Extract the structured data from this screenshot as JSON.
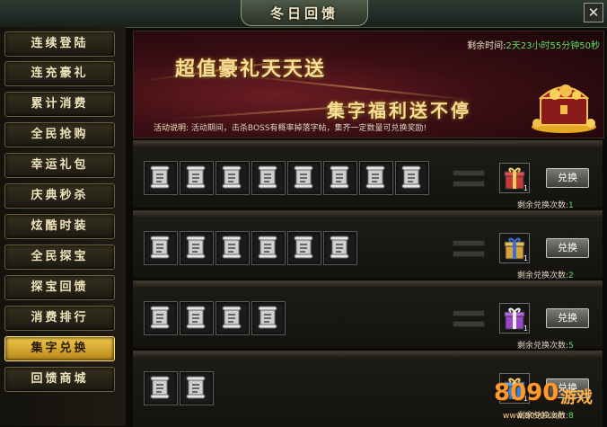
{
  "window": {
    "title": "冬日回馈",
    "close_glyph": "✕"
  },
  "sidebar": {
    "items": [
      {
        "label": "连续登陆",
        "active": false
      },
      {
        "label": "连充豪礼",
        "active": false
      },
      {
        "label": "累计消费",
        "active": false
      },
      {
        "label": "全民抢购",
        "active": false
      },
      {
        "label": "幸运礼包",
        "active": false
      },
      {
        "label": "庆典秒杀",
        "active": false
      },
      {
        "label": "炫酷时装",
        "active": false
      },
      {
        "label": "全民探宝",
        "active": false
      },
      {
        "label": "探宝回馈",
        "active": false
      },
      {
        "label": "消费排行",
        "active": false
      },
      {
        "label": "集字兑换",
        "active": true
      },
      {
        "label": "回馈商城",
        "active": false
      }
    ]
  },
  "banner": {
    "title1": "超值豪礼天天送",
    "title2": "集字福利送不停",
    "time_label": "剩余时间:",
    "time_value": "2天23小时55分钟50秒",
    "desc_label": "活动说明:",
    "desc_text": "活动期间，击杀BOSS有概率掉落字帖，集齐一定数量可兑换奖励!",
    "chest_icon": "treasure-chest-icon"
  },
  "rows": [
    {
      "slots": 8,
      "reward_icon": "gift-box-icon",
      "reward_color": "#c63a3a",
      "reward_count": "1",
      "button": "兑换",
      "remain_label": "剩余兑换次数:",
      "remain_value": "1"
    },
    {
      "slots": 6,
      "reward_icon": "gift-box-icon",
      "reward_color": "#d8a33a",
      "reward_count": "1",
      "button": "兑换",
      "remain_label": "剩余兑换次数:",
      "remain_value": "2"
    },
    {
      "slots": 4,
      "reward_icon": "gift-box-icon",
      "reward_color": "#9a46c8",
      "reward_count": "1",
      "button": "兑换",
      "remain_label": "剩余兑换次数:",
      "remain_value": "5"
    },
    {
      "slots": 2,
      "reward_icon": "gift-box-icon",
      "reward_color": "#3a7fd8",
      "reward_count": "1",
      "button": "兑换",
      "remain_label": "剩余兑换次数:",
      "remain_value": "8"
    }
  ],
  "slot_icon": "scroll-icon",
  "watermark": {
    "logo": "8090",
    "word": "游戏",
    "url": "www.8090.com"
  }
}
